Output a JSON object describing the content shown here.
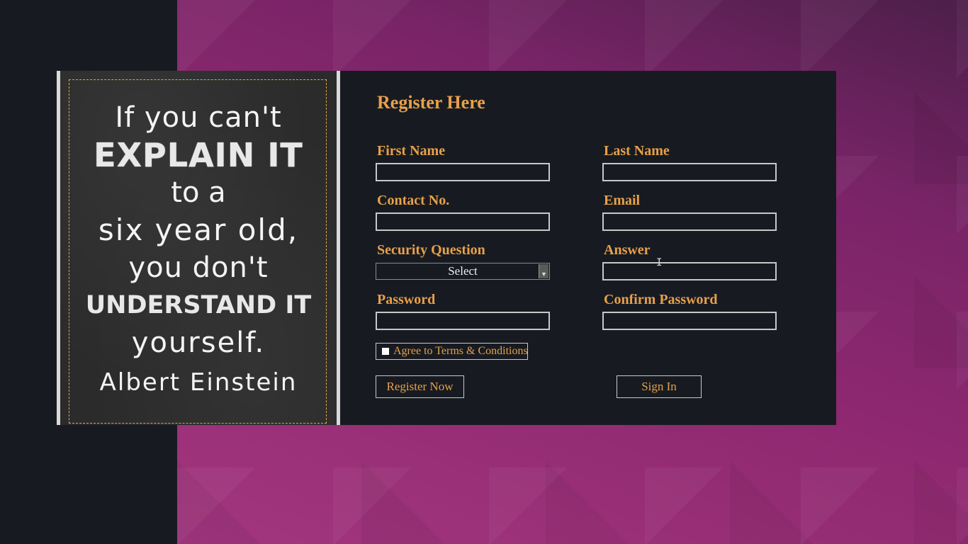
{
  "quote": {
    "line1": "If you can't",
    "line2": "EXPLAIN IT",
    "line3": "to a",
    "line4": "six year old,",
    "line5": "you don't",
    "line6": "UNDERSTAND IT",
    "line7": "yourself.",
    "author": "Albert Einstein"
  },
  "form": {
    "title": "Register Here",
    "first_name_label": "First Name",
    "last_name_label": "Last Name",
    "contact_label": "Contact No.",
    "email_label": "Email",
    "security_question_label": "Security Question",
    "security_question_value": "Select",
    "answer_label": "Answer",
    "password_label": "Password",
    "confirm_password_label": "Confirm Password",
    "terms_label": "Agree to Terms & Conditions",
    "register_button": "Register Now",
    "signin_button": "Sign In"
  },
  "colors": {
    "accent": "#e8a04a",
    "panel": "#171b21",
    "background_gradient": [
      "#4c1f49",
      "#a2367f"
    ]
  }
}
